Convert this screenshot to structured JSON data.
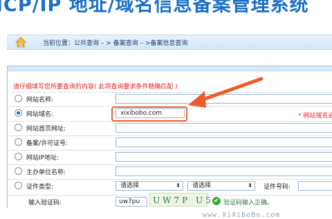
{
  "header": {
    "title": "ICP/IP 地址/域名信息备案管理系统"
  },
  "breadcrumb": {
    "text": "当前位置：公共查询  – >  备案查询  – >备案信息查询"
  },
  "form": {
    "instruction": "请仔细填写您所要查询的内容( 此项查询要求条件精确匹配 )",
    "rows": [
      {
        "label": "网站名称:",
        "value": ""
      },
      {
        "label": "网站域名:",
        "value": "xixibobo.com"
      },
      {
        "label": "网站首页网址:",
        "value": ""
      },
      {
        "label": "备案/许可证号:",
        "value": ""
      },
      {
        "label": "网站IP地址:",
        "value": ""
      },
      {
        "label": "主办单位名称:",
        "value": ""
      },
      {
        "label": "证件类型:"
      }
    ],
    "required_note": "* 网站域名必",
    "cert_type_select": "请选择",
    "cert_subtype_select": "请选择",
    "cert_number_label": "证件号码:",
    "captcha_label": "输入验证码:",
    "captcha_value": "uw7pu",
    "captcha_image_text": "UW7P U5",
    "captcha_ok": "验证码输入正确。"
  },
  "watermark": "www.XiXiBoBo.com",
  "colors": {
    "accent": "#1a6fc7",
    "error": "#e52222",
    "highlight": "#f05a28",
    "success": "#2e7a2e"
  }
}
